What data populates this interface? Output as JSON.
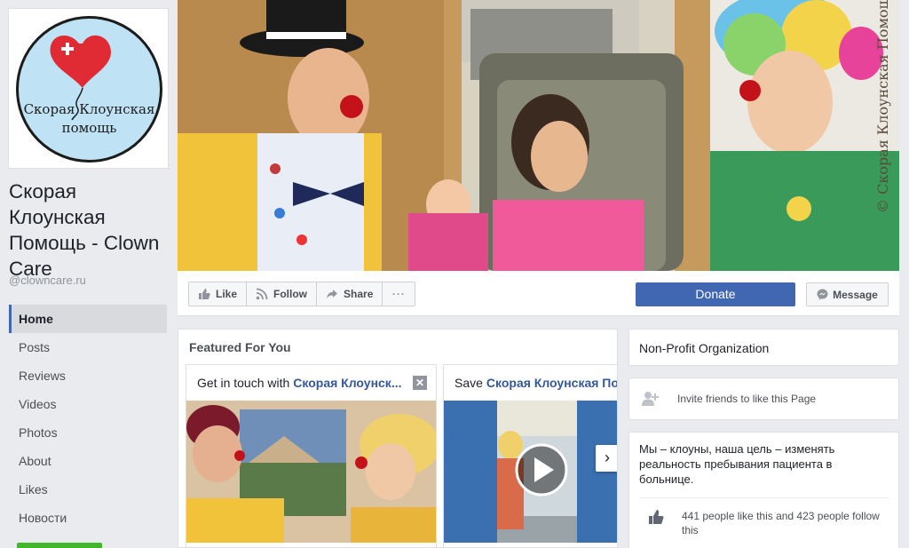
{
  "profile": {
    "logo_text_line1": "Скорая Клоунская",
    "logo_text_line2": "помощь",
    "name": "Скорая Клоунская Помощь - Clown Care",
    "handle": "@clowncare.ru"
  },
  "nav": {
    "items": [
      {
        "label": "Home"
      },
      {
        "label": "Posts"
      },
      {
        "label": "Reviews"
      },
      {
        "label": "Videos"
      },
      {
        "label": "Photos"
      },
      {
        "label": "About"
      },
      {
        "label": "Likes"
      },
      {
        "label": "Новости"
      }
    ]
  },
  "cover": {
    "watermark": "© Скорая Клоунская Помощь"
  },
  "actions": {
    "like": "Like",
    "follow": "Follow",
    "share": "Share",
    "more": "···",
    "donate": "Donate",
    "message": "Message"
  },
  "featured": {
    "title": "Featured For You",
    "card1": {
      "prefix": "Get in touch with",
      "highlight": "Скорая Клоунск...",
      "close": "✕"
    },
    "card2": {
      "prefix": "Save",
      "highlight": "Скорая Клоунская Пом"
    },
    "next": "›"
  },
  "sidebar": {
    "category": "Non-Profit Organization",
    "invite": "Invite friends to like this Page",
    "about": "Мы – клоуны, наша цель – изменять реальность пребывания пациента в больнице.",
    "likes": "441 people like this and 423 people follow this"
  },
  "colors": {
    "accent": "#4267b2",
    "link": "#365899",
    "background": "#e9ebee"
  }
}
